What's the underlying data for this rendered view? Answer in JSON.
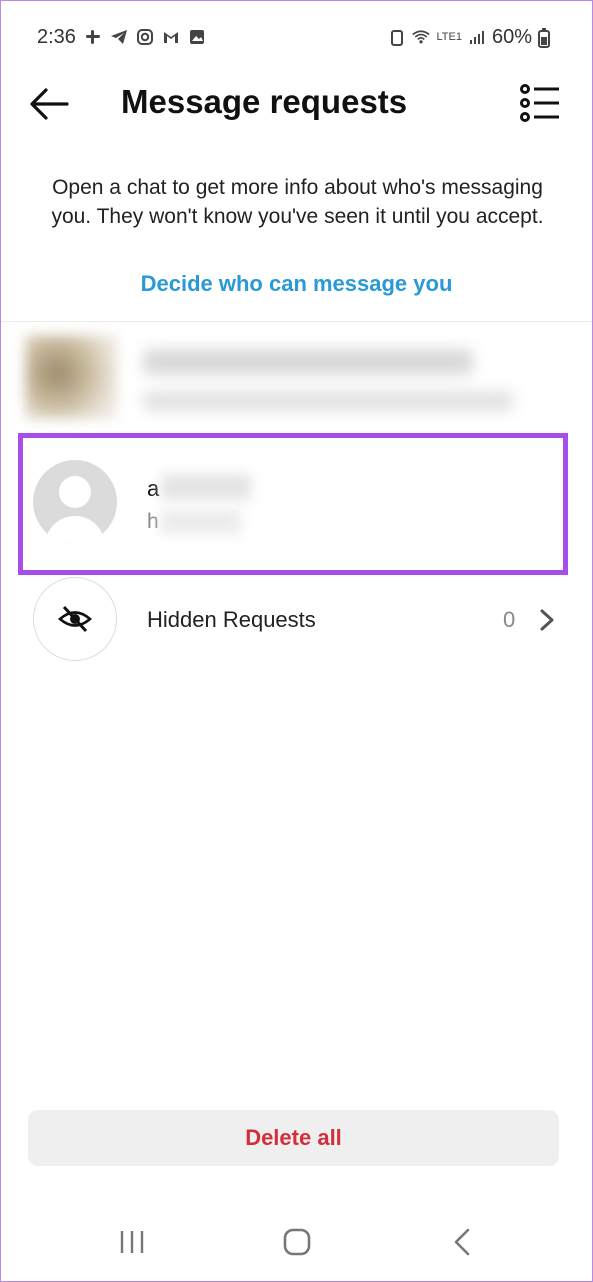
{
  "status_bar": {
    "time": "2:36",
    "battery": "60%",
    "network_label": "LTE1"
  },
  "header": {
    "title": "Message requests"
  },
  "info": {
    "text": "Open a chat to get more info about who's messaging you. They won't know you've seen it until you accept.",
    "link_label": "Decide who can message you"
  },
  "requests": [
    {
      "name_initial": "a",
      "message_initial": "h"
    }
  ],
  "hidden_requests": {
    "label": "Hidden Requests",
    "count": "0"
  },
  "actions": {
    "delete_all_label": "Delete all"
  },
  "colors": {
    "accent_link": "#2a9ad6",
    "delete_red": "#d32f3a",
    "highlight_purple": "#a64fe8"
  }
}
